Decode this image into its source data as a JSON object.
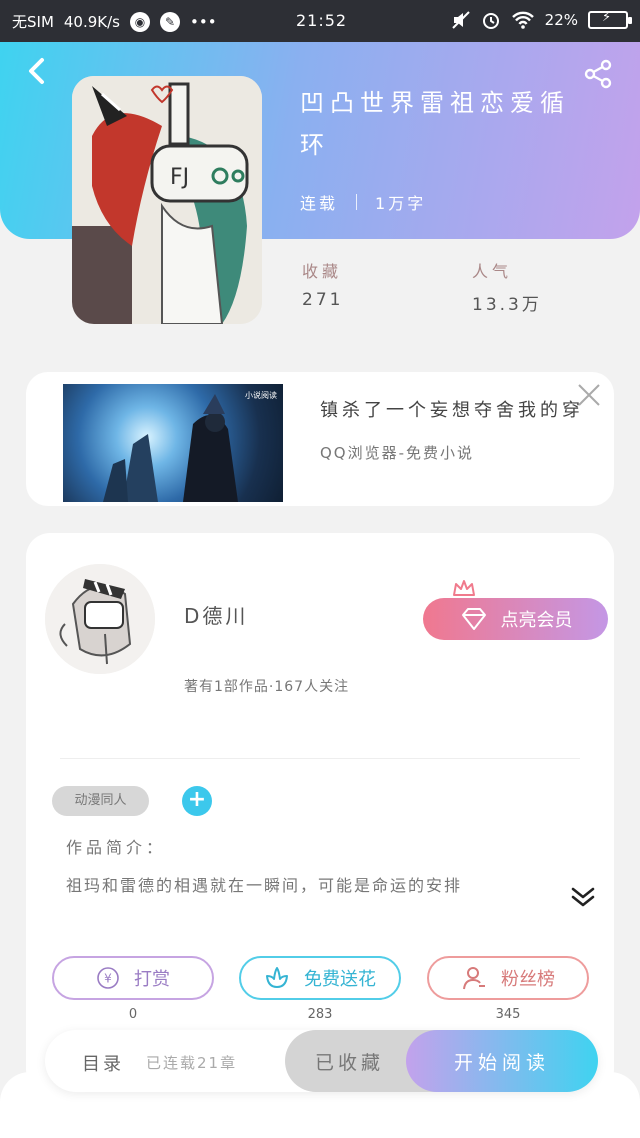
{
  "status_bar": {
    "carrier": "无SIM",
    "speed": "40.9K/s",
    "more": "•••",
    "time": "21:52",
    "battery": "22%"
  },
  "book": {
    "title": "凹凸世界雷祖恋爱循环",
    "status": "连载",
    "word_count": "1万字",
    "favorites_label": "收藏",
    "favorites_value": "271",
    "popularity_label": "人气",
    "popularity_value": "13.3万"
  },
  "ad": {
    "title": "镇杀了一个妄想夺舍我的穿",
    "subtitle": "QQ浏览器-免费小说",
    "image_watermark": "小说阅读"
  },
  "author": {
    "name": "D德川",
    "meta": "著有1部作品·167人关注",
    "vip_label": "点亮会员"
  },
  "tags": [
    "动漫同人"
  ],
  "tag_add_label": "+",
  "intro": {
    "label": "作品简介：",
    "text": "祖玛和雷德的相遇就在一瞬间，可能是命运的安排"
  },
  "actions": {
    "reward_label": "打赏",
    "reward_count": "0",
    "reward_icon_glyph": "¥",
    "flower_label": "免费送花",
    "flower_count": "283",
    "fans_label": "粉丝榜",
    "fans_count": "345"
  },
  "bottom": {
    "toc_label": "目录",
    "toc_status": "已连载21章",
    "collected_label": "已收藏",
    "read_label": "开始阅读"
  },
  "icons": {
    "back": "chevron-left-icon",
    "share": "share-icon",
    "close": "close-icon",
    "expand": "double-chevron-down-icon",
    "crown": "crown-icon",
    "diamond": "diamond-icon",
    "flower": "flower-icon",
    "person": "person-icon",
    "yen": "yen-icon"
  },
  "colors": {
    "header_gradient_start": "#3fd3f0",
    "header_gradient_end": "#c3a2ec",
    "vip_gradient_start": "#f0788f",
    "vip_gradient_end": "#c497e5",
    "tag_add": "#3cc8ec"
  }
}
